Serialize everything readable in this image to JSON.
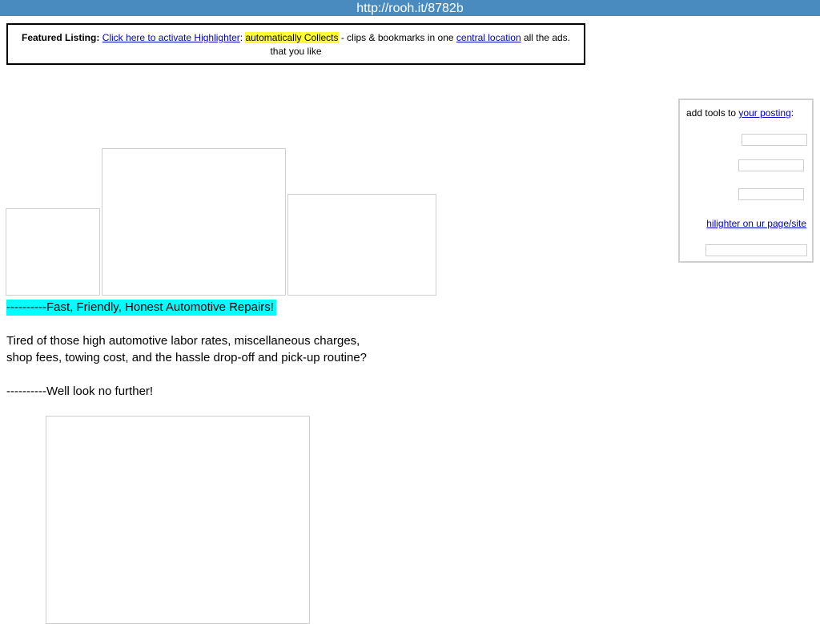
{
  "header": {
    "url": "http://rooh.it/8782b"
  },
  "featured": {
    "label": "Featured Listing:",
    "activate_link": "Click here to activate Highlighter",
    "colon": ":",
    "highlight_text": "automatically Collects",
    "middle_text": " - clips & bookmarks in one ",
    "location_link": "central location",
    "tail_text": " all the ads. that you like"
  },
  "ad": {
    "headline": "----------Fast, Friendly, Honest Automotive Repairs!",
    "paragraph_line1": "Tired of those high automotive labor rates, miscellaneous charges,",
    "paragraph_line2": "shop fees, towing cost, and the hassle drop-off and pick-up routine?",
    "closing": "----------Well look no further!"
  },
  "tools": {
    "prefix": "add tools to ",
    "posting_link": "your posting",
    "suffix": ":",
    "hilighter_link": "hilighter on ur page/site"
  },
  "colors": {
    "topbar": "#4a8bbf",
    "headline_bg": "#00ffff",
    "highlight": "#ffff33",
    "link": "#0000cc"
  }
}
